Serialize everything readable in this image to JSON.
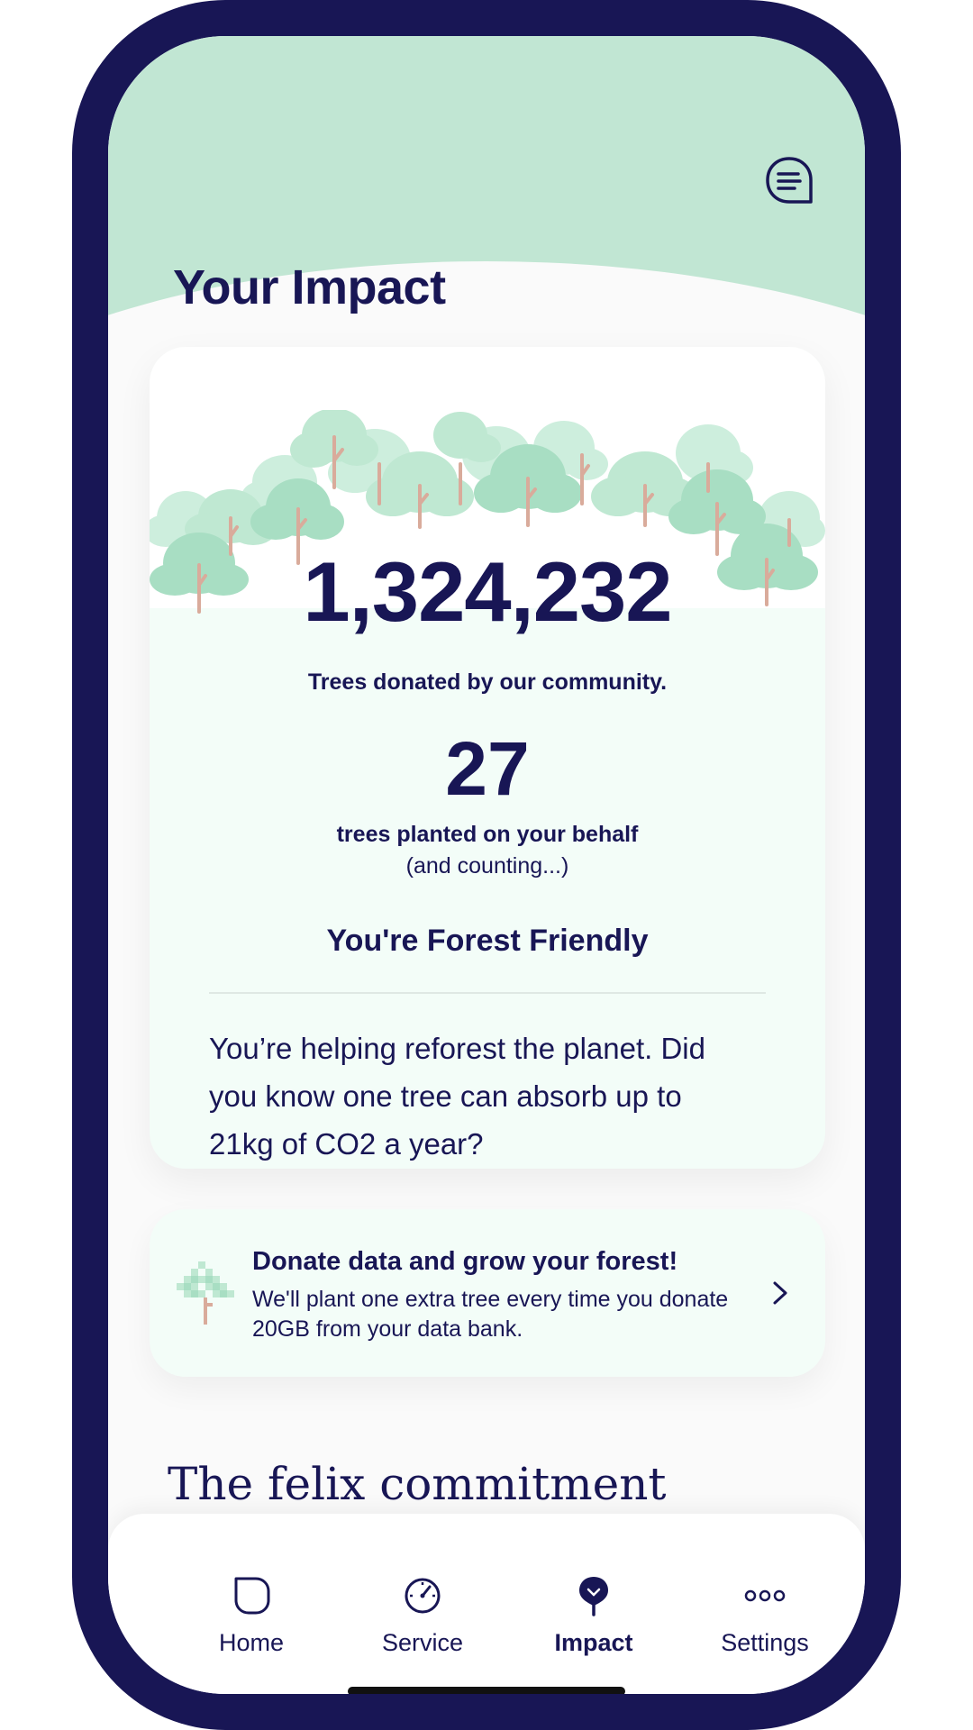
{
  "header": {
    "title": "Your Impact",
    "message_icon": "chat-lines-icon"
  },
  "impact": {
    "total_trees": "1,324,232",
    "total_caption": "Trees donated by our community.",
    "user_trees": "27",
    "user_caption": "trees planted on your behalf",
    "user_sub": "(and counting...)",
    "status_title": "You're Forest Friendly",
    "body": "You’re helping reforest the planet. Did you know one tree can absorb up to 21kg of CO2 a year?"
  },
  "donate": {
    "title": "Donate data and grow your forest!",
    "body": "We'll plant one extra tree every time you donate 20GB from your data bank.",
    "icon": "pixel-tree-icon",
    "chevron_icon": "chevron-right-icon"
  },
  "commitment": {
    "title": "The felix commitment"
  },
  "tabs": [
    {
      "label": "Home",
      "icon": "leaf-icon"
    },
    {
      "label": "Service",
      "icon": "gauge-icon"
    },
    {
      "label": "Impact",
      "icon": "tree-pin-icon",
      "active": true
    },
    {
      "label": "Settings",
      "icon": "dots-icon"
    }
  ],
  "colors": {
    "navy": "#181655",
    "mint": "#c1e6d3",
    "card_bg": "#f3fdf8",
    "tree_light": "#cdeedd",
    "tree_dark": "#a8dec3",
    "trunk": "#d9ab9b"
  }
}
